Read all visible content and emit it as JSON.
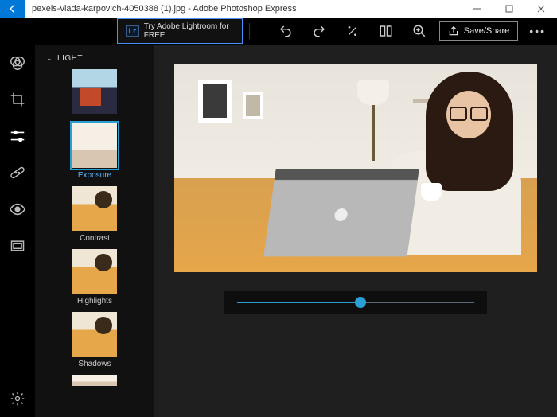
{
  "titlebar": {
    "filename": "pexels-vlada-karpovich-4050388 (1).jpg",
    "app_name": "Adobe Photoshop Express",
    "separator": " - "
  },
  "toolbar": {
    "lightroom_badge": "Lr",
    "lightroom_label": "Try Adobe Lightroom for FREE",
    "save_label": "Save/Share"
  },
  "panel": {
    "section": "LIGHT",
    "items": [
      {
        "label": "",
        "kind": "looks",
        "selected": false
      },
      {
        "label": "Exposure",
        "kind": "exposure",
        "selected": true
      },
      {
        "label": "Contrast",
        "kind": "main",
        "selected": false
      },
      {
        "label": "Highlights",
        "kind": "main",
        "selected": false
      },
      {
        "label": "Shadows",
        "kind": "main",
        "selected": false
      }
    ]
  },
  "slider": {
    "value": 52,
    "min": 0,
    "max": 100
  },
  "colors": {
    "accent": "#2a9fd6",
    "bg": "#1a1a1a"
  }
}
